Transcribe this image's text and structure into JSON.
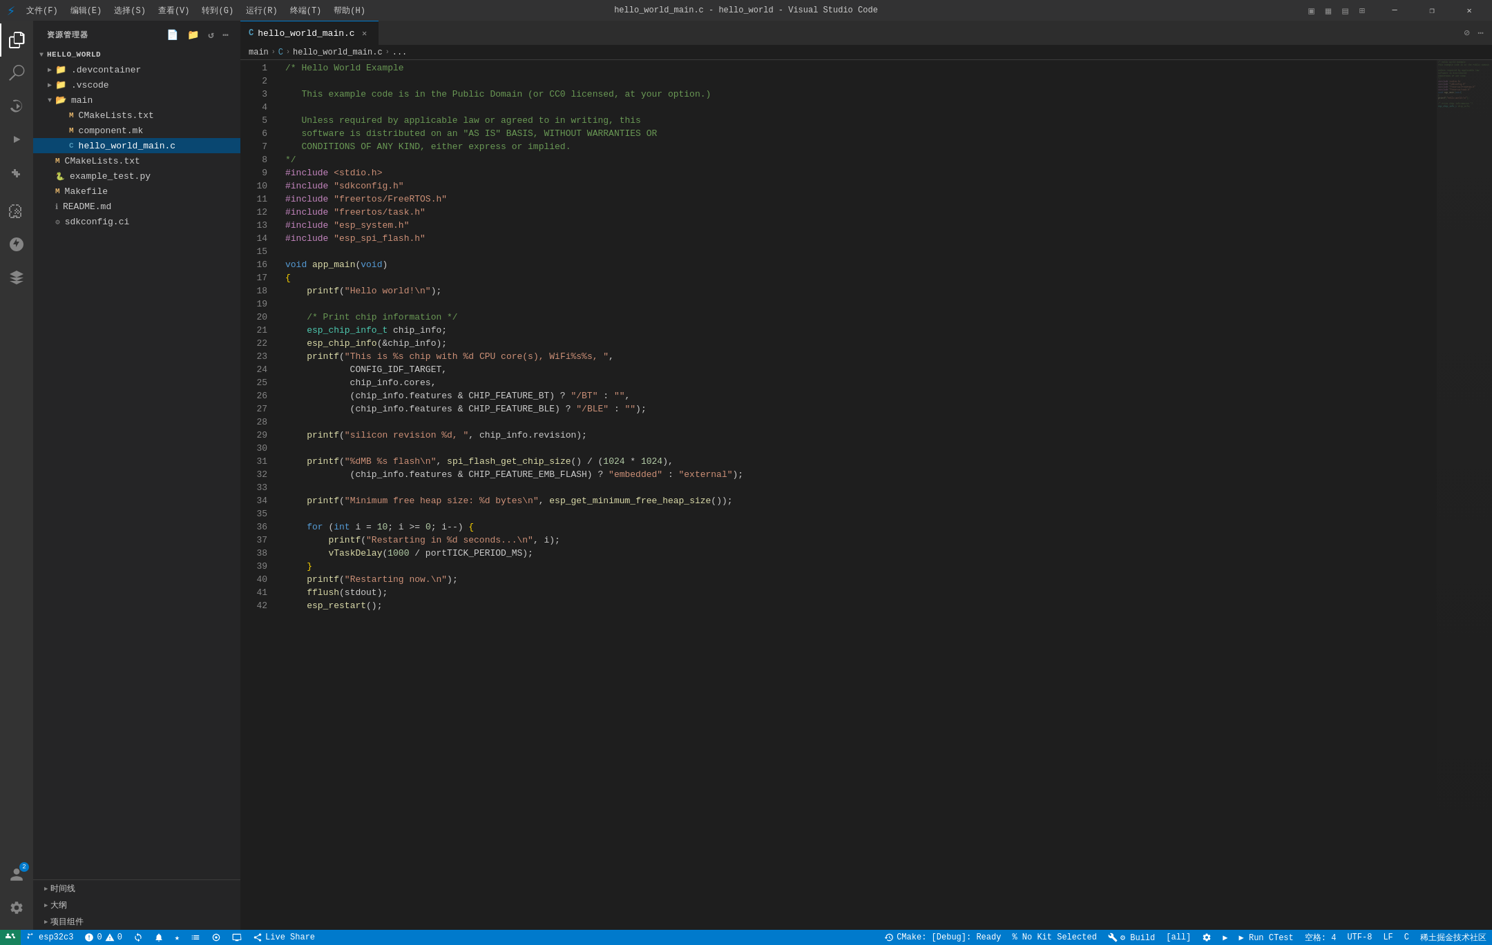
{
  "titleBar": {
    "logo": "⚡",
    "menus": [
      "文件(F)",
      "编辑(E)",
      "选择(S)",
      "查看(V)",
      "转到(G)",
      "运行(R)",
      "终端(T)",
      "帮助(H)"
    ],
    "title": "hello_world_main.c - hello_world - Visual Studio Code",
    "winBtns": [
      "—",
      "❐",
      "✕"
    ]
  },
  "activityBar": {
    "items": [
      {
        "icon": "🗂",
        "name": "explorer",
        "active": true
      },
      {
        "icon": "🔍",
        "name": "search",
        "active": false
      },
      {
        "icon": "⑂",
        "name": "source-control",
        "active": false
      },
      {
        "icon": "▶",
        "name": "run-debug",
        "active": false
      },
      {
        "icon": "⊞",
        "name": "extensions",
        "active": false
      },
      {
        "icon": "📡",
        "name": "remote",
        "active": false
      },
      {
        "icon": "🔧",
        "name": "cmake",
        "active": false
      },
      {
        "icon": "🌐",
        "name": "esp-idf",
        "active": false
      }
    ],
    "bottomItems": [
      {
        "icon": "👤",
        "name": "account",
        "badge": "2"
      },
      {
        "icon": "⚙",
        "name": "settings"
      }
    ]
  },
  "sidebar": {
    "title": "资源管理器",
    "headerIcons": [
      "📄",
      "📁",
      "↺",
      "⋯"
    ],
    "tree": {
      "root": "HELLO_WORLD",
      "items": [
        {
          "name": ".devcontainer",
          "type": "folder",
          "level": 1,
          "expanded": false
        },
        {
          "name": ".vscode",
          "type": "folder",
          "level": 1,
          "expanded": false
        },
        {
          "name": "main",
          "type": "folder",
          "level": 1,
          "expanded": true
        },
        {
          "name": "CMakeLists.txt",
          "type": "file-m",
          "level": 2
        },
        {
          "name": "component.mk",
          "type": "file-m",
          "level": 2
        },
        {
          "name": "hello_world_main.c",
          "type": "file-c",
          "level": 2,
          "active": true
        },
        {
          "name": "CMakeLists.txt",
          "type": "file-m",
          "level": 1
        },
        {
          "name": "example_test.py",
          "type": "file-py",
          "level": 1
        },
        {
          "name": "Makefile",
          "type": "file-m",
          "level": 1
        },
        {
          "name": "README.md",
          "type": "file-info",
          "level": 1
        },
        {
          "name": "sdkconfig.ci",
          "type": "file-gear",
          "level": 1
        }
      ]
    },
    "footerItems": [
      {
        "label": "时间线"
      },
      {
        "label": "大纲"
      },
      {
        "label": "项目组件"
      }
    ]
  },
  "tabs": [
    {
      "name": "hello_world_main.c",
      "type": "c",
      "active": true,
      "modified": false
    }
  ],
  "breadcrumb": {
    "parts": [
      "main",
      "C",
      "hello_world_main.c",
      "..."
    ]
  },
  "editor": {
    "lines": [
      {
        "num": 1,
        "code": "/* Hello World Example"
      },
      {
        "num": 2,
        "code": ""
      },
      {
        "num": 3,
        "code": "   This example code is in the Public Domain (or CC0 licensed, at your option.)"
      },
      {
        "num": 4,
        "code": ""
      },
      {
        "num": 5,
        "code": "   Unless required by applicable law or agreed to in writing, this"
      },
      {
        "num": 6,
        "code": "   software is distributed on an \"AS IS\" BASIS, WITHOUT WARRANTIES OR"
      },
      {
        "num": 7,
        "code": "   CONDITIONS OF ANY KIND, either express or implied."
      },
      {
        "num": 8,
        "code": "*/"
      },
      {
        "num": 9,
        "code": "#include <stdio.h>"
      },
      {
        "num": 10,
        "code": "#include \"sdkconfig.h\""
      },
      {
        "num": 11,
        "code": "#include \"freertos/FreeRTOS.h\""
      },
      {
        "num": 12,
        "code": "#include \"freertos/task.h\""
      },
      {
        "num": 13,
        "code": "#include \"esp_system.h\""
      },
      {
        "num": 14,
        "code": "#include \"esp_spi_flash.h\""
      },
      {
        "num": 15,
        "code": ""
      },
      {
        "num": 16,
        "code": "void app_main(void)"
      },
      {
        "num": 17,
        "code": "{"
      },
      {
        "num": 18,
        "code": "    printf(\"Hello world!\\n\");"
      },
      {
        "num": 19,
        "code": ""
      },
      {
        "num": 20,
        "code": "    /* Print chip information */"
      },
      {
        "num": 21,
        "code": "    esp_chip_info_t chip_info;"
      },
      {
        "num": 22,
        "code": "    esp_chip_info(&chip_info);"
      },
      {
        "num": 23,
        "code": "    printf(\"This is %s chip with %d CPU core(s), WiFi%s%s, \","
      },
      {
        "num": 24,
        "code": "            CONFIG_IDF_TARGET,"
      },
      {
        "num": 25,
        "code": "            chip_info.cores,"
      },
      {
        "num": 26,
        "code": "            (chip_info.features & CHIP_FEATURE_BT) ? \"/BT\" : \"\","
      },
      {
        "num": 27,
        "code": "            (chip_info.features & CHIP_FEATURE_BLE) ? \"/BLE\" : \"\");"
      },
      {
        "num": 28,
        "code": ""
      },
      {
        "num": 29,
        "code": "    printf(\"silicon revision %d, \", chip_info.revision);"
      },
      {
        "num": 30,
        "code": ""
      },
      {
        "num": 31,
        "code": "    printf(\"%dMB %s flash\\n\", spi_flash_get_chip_size() / (1024 * 1024),"
      },
      {
        "num": 32,
        "code": "            (chip_info.features & CHIP_FEATURE_EMB_FLASH) ? \"embedded\" : \"external\");"
      },
      {
        "num": 33,
        "code": ""
      },
      {
        "num": 34,
        "code": "    printf(\"Minimum free heap size: %d bytes\\n\", esp_get_minimum_free_heap_size());"
      },
      {
        "num": 35,
        "code": ""
      },
      {
        "num": 36,
        "code": "    for (int i = 10; i >= 0; i--) {"
      },
      {
        "num": 37,
        "code": "        printf(\"Restarting in %d seconds...\\n\", i);"
      },
      {
        "num": 38,
        "code": "        vTaskDelay(1000 / portTICK_PERIOD_MS);"
      },
      {
        "num": 39,
        "code": "    }"
      },
      {
        "num": 40,
        "code": "    printf(\"Restarting now.\\n\");"
      },
      {
        "num": 41,
        "code": "    fflush(stdout);"
      },
      {
        "num": 42,
        "code": "    esp_restart();"
      }
    ]
  },
  "statusBar": {
    "left": [
      {
        "text": "⎇ esp32c3",
        "icon": "branch-icon"
      },
      {
        "text": "⚠ 0 △ 0",
        "icon": "error-icon"
      },
      {
        "text": "✓",
        "icon": "check-icon"
      }
    ],
    "liveShare": "$(live-share) Live Share",
    "liveShareText": "Live Share",
    "cmake": "CMake: [Debug]: Ready",
    "kit": "% No Kit Selected",
    "build": "⚙ Build",
    "buildAll": "[all]",
    "run": "▶ Run CTest",
    "right": [
      {
        "text": "空格: 4"
      },
      {
        "text": "UTF-8"
      },
      {
        "text": "LF"
      },
      {
        "text": "C"
      },
      {
        "text": "稀土掘金技术社区"
      }
    ]
  }
}
